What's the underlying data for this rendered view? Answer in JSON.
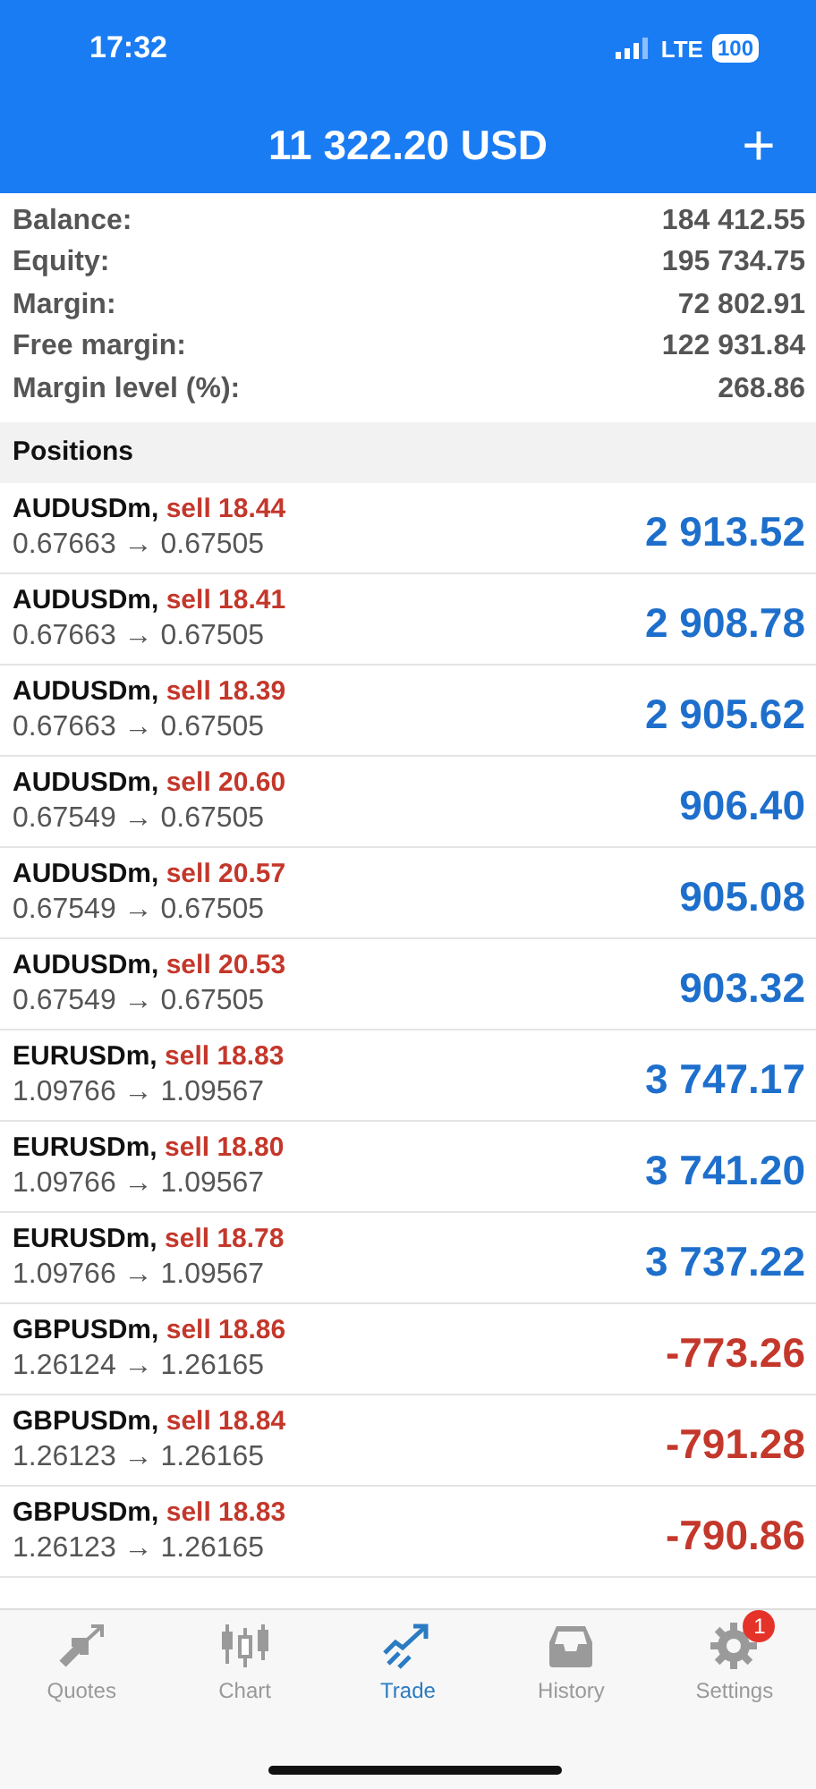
{
  "status_bar": {
    "time": "17:32",
    "network": "LTE",
    "battery": "100"
  },
  "header": {
    "title": "11 322.20 USD",
    "add_button": "+"
  },
  "summary": [
    {
      "label": "Balance:",
      "value": "184 412.55"
    },
    {
      "label": "Equity:",
      "value": "195 734.75"
    },
    {
      "label": "Margin:",
      "value": "72 802.91"
    },
    {
      "label": "Free margin:",
      "value": "122 931.84"
    },
    {
      "label": "Margin level (%):",
      "value": "268.86"
    }
  ],
  "positions_heading": "Positions",
  "positions": [
    {
      "symbol": "AUDUSDm,",
      "order": "sell 18.44",
      "prices": "0.67663 → 0.67505",
      "profit": "2 913.52",
      "kind": "profit"
    },
    {
      "symbol": "AUDUSDm,",
      "order": "sell 18.41",
      "prices": "0.67663 → 0.67505",
      "profit": "2 908.78",
      "kind": "profit"
    },
    {
      "symbol": "AUDUSDm,",
      "order": "sell 18.39",
      "prices": "0.67663 → 0.67505",
      "profit": "2 905.62",
      "kind": "profit"
    },
    {
      "symbol": "AUDUSDm,",
      "order": "sell 20.60",
      "prices": "0.67549 → 0.67505",
      "profit": "906.40",
      "kind": "profit"
    },
    {
      "symbol": "AUDUSDm,",
      "order": "sell 20.57",
      "prices": "0.67549 → 0.67505",
      "profit": "905.08",
      "kind": "profit"
    },
    {
      "symbol": "AUDUSDm,",
      "order": "sell 20.53",
      "prices": "0.67549 → 0.67505",
      "profit": "903.32",
      "kind": "profit"
    },
    {
      "symbol": "EURUSDm,",
      "order": "sell 18.83",
      "prices": "1.09766 → 1.09567",
      "profit": "3 747.17",
      "kind": "profit"
    },
    {
      "symbol": "EURUSDm,",
      "order": "sell 18.80",
      "prices": "1.09766 → 1.09567",
      "profit": "3 741.20",
      "kind": "profit"
    },
    {
      "symbol": "EURUSDm,",
      "order": "sell 18.78",
      "prices": "1.09766 → 1.09567",
      "profit": "3 737.22",
      "kind": "profit"
    },
    {
      "symbol": "GBPUSDm,",
      "order": "sell 18.86",
      "prices": "1.26124 → 1.26165",
      "profit": "-773.26",
      "kind": "loss"
    },
    {
      "symbol": "GBPUSDm,",
      "order": "sell 18.84",
      "prices": "1.26123 → 1.26165",
      "profit": "-791.28",
      "kind": "loss"
    },
    {
      "symbol": "GBPUSDm,",
      "order": "sell 18.83",
      "prices": "1.26123 → 1.26165",
      "profit": "-790.86",
      "kind": "loss"
    }
  ],
  "tabs": [
    {
      "label": "Quotes",
      "kind": "quotes",
      "selected": false
    },
    {
      "label": "Chart",
      "kind": "chart",
      "selected": false
    },
    {
      "label": "Trade",
      "kind": "trade",
      "selected": true
    },
    {
      "label": "History",
      "kind": "history",
      "selected": false
    },
    {
      "label": "Settings",
      "kind": "settings",
      "selected": false,
      "badge": "1"
    }
  ]
}
